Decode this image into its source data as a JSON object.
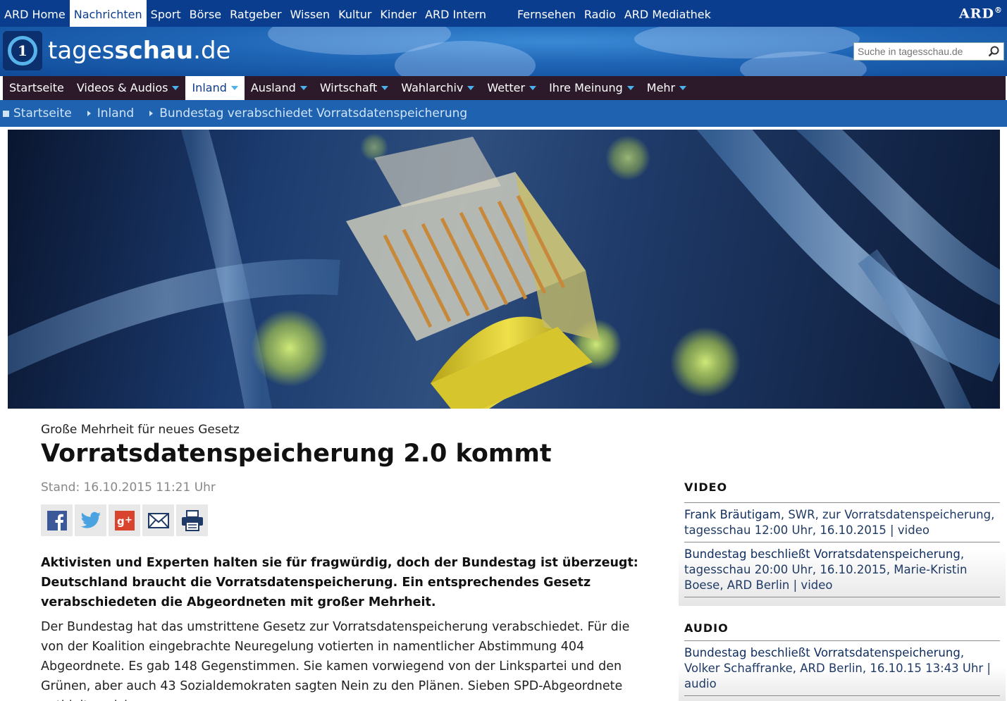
{
  "ard_bar": {
    "items_left": [
      "ARD Home",
      "Nachrichten",
      "Sport",
      "Börse",
      "Ratgeber",
      "Wissen",
      "Kultur",
      "Kinder",
      "ARD Intern"
    ],
    "active_index": 1,
    "items_right": [
      "Fernsehen",
      "Radio",
      "ARD Mediathek"
    ],
    "logo": "ARD"
  },
  "header": {
    "logo_prefix": "tages",
    "logo_bold": "schau",
    "logo_suffix": ".de",
    "search_placeholder": "Suche in tagesschau.de"
  },
  "mainnav": {
    "items": [
      {
        "label": "Startseite",
        "dropdown": false
      },
      {
        "label": "Videos & Audios",
        "dropdown": true
      },
      {
        "label": "Inland",
        "dropdown": true,
        "active": true
      },
      {
        "label": "Ausland",
        "dropdown": true
      },
      {
        "label": "Wirtschaft",
        "dropdown": true
      },
      {
        "label": "Wahlarchiv",
        "dropdown": true
      },
      {
        "label": "Wetter",
        "dropdown": true
      },
      {
        "label": "Ihre Meinung",
        "dropdown": true
      },
      {
        "label": "Mehr",
        "dropdown": true
      }
    ]
  },
  "breadcrumb": [
    "Startseite",
    "Inland",
    "Bundestag verabschiedet Vorratsdatenspeicherung"
  ],
  "article": {
    "kicker": "Große Mehrheit für neues Gesetz",
    "headline": "Vorratsdatenspeicherung 2.0 kommt",
    "stand": "Stand: 16.10.2015 11:21 Uhr",
    "teaser": "Aktivisten und Experten halten sie für fragwürdig, doch der Bundestag ist überzeugt: Deutschland braucht die Vorratsdatenspeicherung. Ein entsprechendes Gesetz verabschiedeten die Abgeordneten mit großer Mehrheit.",
    "body": "Der Bundestag hat das umstrittene Gesetz zur Vorratsdatenspeicherung verabschiedet. Für die von der Koalition eingebrachte Neuregelung votierten in namentlicher Abstimmung 404 Abgeordnete. Es gab 148 Gegenstimmen. Sie kamen vorwiegend von der Linkspartei und den Grünen, aber auch 43 Sozialdemokraten sagten Nein zu den Plänen. Sieben SPD-Abgeordnete enthielten sich."
  },
  "share_icons": [
    "facebook-icon",
    "twitter-icon",
    "googleplus-icon",
    "mail-icon",
    "print-icon"
  ],
  "sidebar": {
    "video_heading": "VIDEO",
    "video_items": [
      {
        "title": "Frank Bräutigam",
        "rest": ", SWR, zur Vorratsdatenspeicherung, tagesschau 12:00 Uhr, 16.10.2015 | video"
      },
      {
        "title": "Bundestag beschließt Vorratsdatenspeicherung",
        "rest": ", tagesschau 20:00 Uhr, 16.10.2015, Marie-Kristin Boese, ARD Berlin | video"
      }
    ],
    "audio_heading": "AUDIO",
    "audio_items": [
      {
        "title": "Bundestag beschließt Vorratsdatenspeicherung",
        "rest": ", Volker Schaffranke, ARD Berlin, 16.10.15 13:43 Uhr | audio"
      }
    ]
  },
  "colors": {
    "ard_blue": "#0b3d8e",
    "nav_dark": "#2c1a2a",
    "breadcrumb_blue": "#1f62b0",
    "accent_triangle": "#4ab2ee"
  }
}
